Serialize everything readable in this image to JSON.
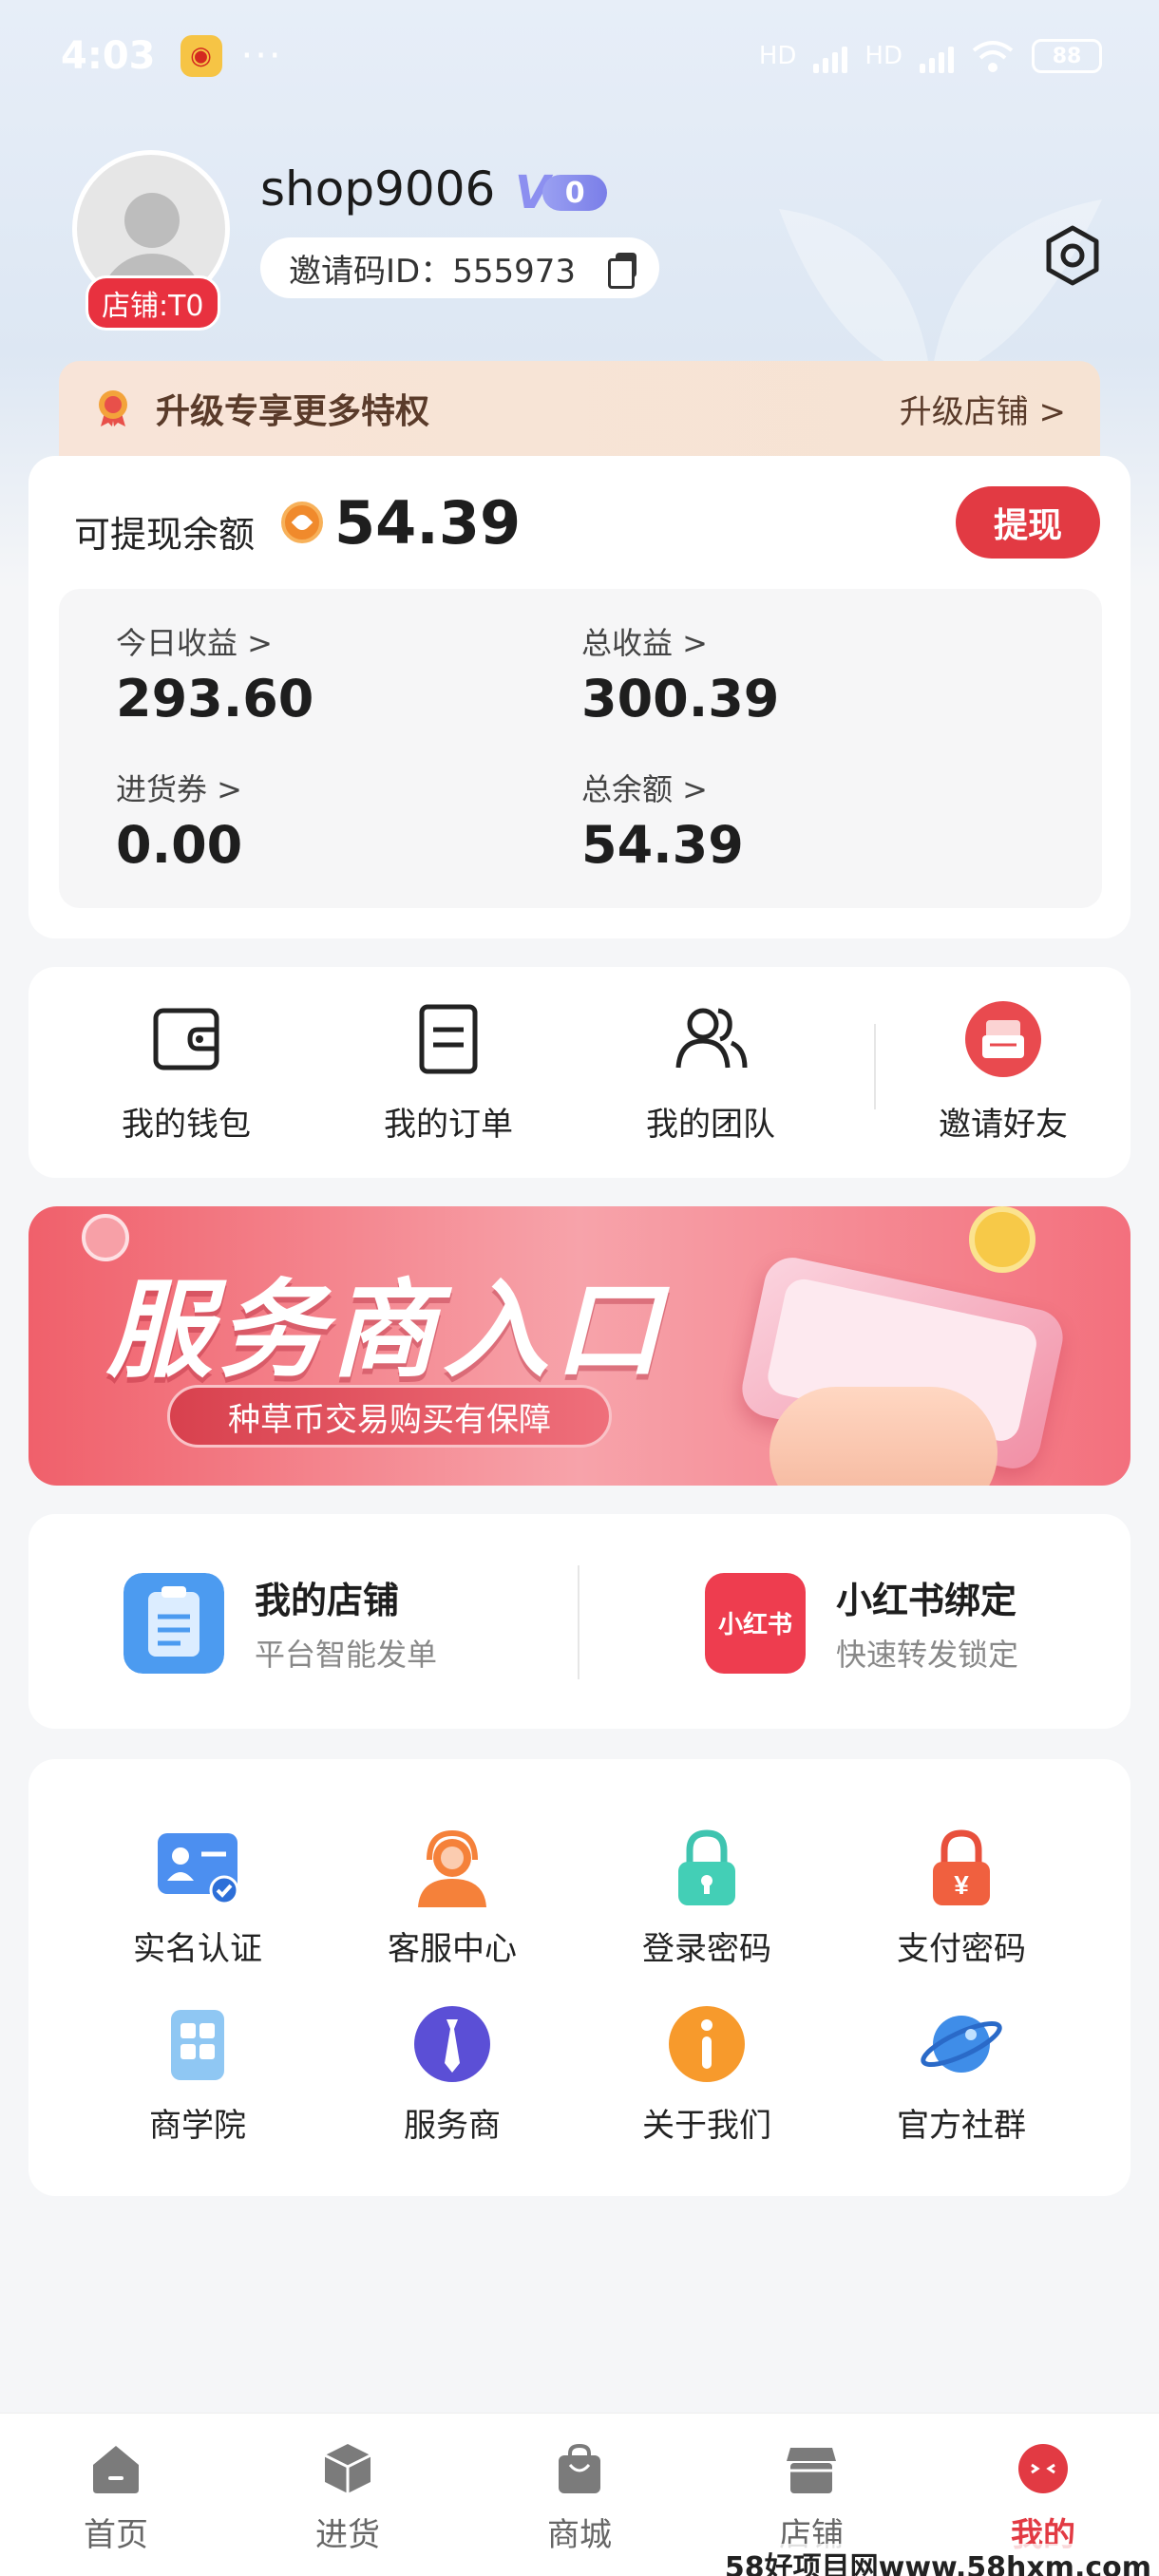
{
  "status_bar": {
    "time": "4:03",
    "dots": "···",
    "network_1": "HD",
    "network_2": "HD",
    "battery": "88"
  },
  "profile": {
    "username": "shop9006",
    "vip_letter": "V",
    "vip_level": "0",
    "shop_badge": "店铺:T0",
    "invite_code": "邀请码ID：555973"
  },
  "upgrade": {
    "text": "升级专享更多特权",
    "link": "升级店铺 >"
  },
  "balance": {
    "label": "可提现余额",
    "value": "54.39",
    "withdraw_label": "提现",
    "stats": [
      {
        "label": "今日收益 >",
        "value": "293.60"
      },
      {
        "label": "总收益 >",
        "value": "300.39"
      },
      {
        "label": "进货券 >",
        "value": "0.00"
      },
      {
        "label": "总余额 >",
        "value": "54.39"
      }
    ]
  },
  "quick_actions": [
    {
      "label": "我的钱包",
      "icon": "wallet-icon"
    },
    {
      "label": "我的订单",
      "icon": "order-icon"
    },
    {
      "label": "我的团队",
      "icon": "team-icon"
    },
    {
      "label": "邀请好友",
      "icon": "invite-icon"
    }
  ],
  "banner": {
    "title": "服务商入口",
    "subtitle": "种草币交易购买有保障"
  },
  "shop_links": [
    {
      "name": "我的店铺",
      "desc": "平台智能发单",
      "icon": "clipboard-icon"
    },
    {
      "name": "小红书绑定",
      "desc": "快速转发锁定",
      "icon": "xiaohongshu-icon",
      "icon_text": "小红书"
    }
  ],
  "services": [
    {
      "label": "实名认证",
      "icon": "id-verify-icon"
    },
    {
      "label": "客服中心",
      "icon": "customer-service-icon"
    },
    {
      "label": "登录密码",
      "icon": "lock-icon"
    },
    {
      "label": "支付密码",
      "icon": "pay-lock-icon"
    },
    {
      "label": "商学院",
      "icon": "academy-icon"
    },
    {
      "label": "服务商",
      "icon": "provider-icon"
    },
    {
      "label": "关于我们",
      "icon": "info-icon"
    },
    {
      "label": "官方社群",
      "icon": "planet-icon"
    }
  ],
  "tabbar": [
    {
      "label": "首页",
      "icon": "home-icon"
    },
    {
      "label": "进货",
      "icon": "box-icon"
    },
    {
      "label": "商城",
      "icon": "bag-icon"
    },
    {
      "label": "店铺",
      "icon": "store-icon"
    },
    {
      "label": "我的",
      "icon": "profile-face-icon"
    }
  ],
  "watermark": "58好项目网www.58hxm.com",
  "colors": {
    "accent": "#e23a43",
    "header_bg": "#e7eef8",
    "page_bg": "#f5f6f8"
  }
}
